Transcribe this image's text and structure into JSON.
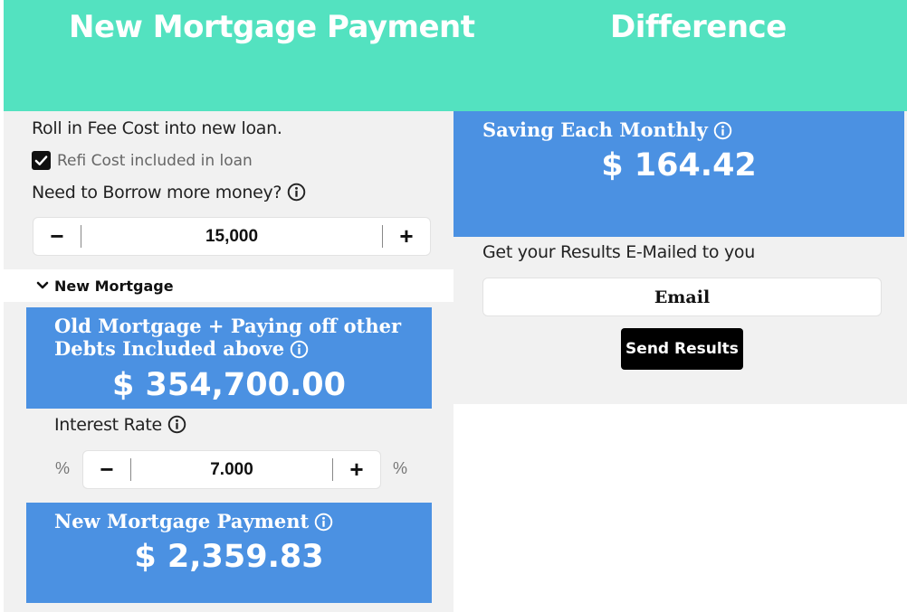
{
  "header": {
    "left_title": "New Mortgage Payment",
    "right_title": "Difference"
  },
  "left": {
    "roll_in_label": "Roll in Fee Cost into new loan.",
    "refi_checkbox": {
      "label": "Refi Cost included in loan",
      "checked": true
    },
    "borrow_label": "Need to Borrow more money?",
    "borrow_stepper": {
      "minus": "−",
      "value": "15,000",
      "plus": "+"
    },
    "accordion_label": "New Mortgage",
    "old_mortgage_card": {
      "title_line1": "Old Mortgage + Paying off other",
      "title_line2": "Debts Included above",
      "value": "$ 354,700.00"
    },
    "interest_label": "Interest Rate",
    "interest_stepper": {
      "prefix": "%",
      "minus": "−",
      "value": "7.000",
      "plus": "+",
      "suffix": "%"
    },
    "new_payment_card": {
      "title": "New Mortgage Payment",
      "value": "$ 2,359.83"
    }
  },
  "right": {
    "saving_card": {
      "title": "Saving Each Monthly",
      "value": "$ 164.42"
    },
    "email_label": "Get your Results E-Mailed to you",
    "email_placeholder": "Email",
    "send_button": "Send Results"
  },
  "colors": {
    "header_bg": "#53e2c0",
    "card_blue": "#4b91e2",
    "panel_bg": "#f1f1f1"
  }
}
